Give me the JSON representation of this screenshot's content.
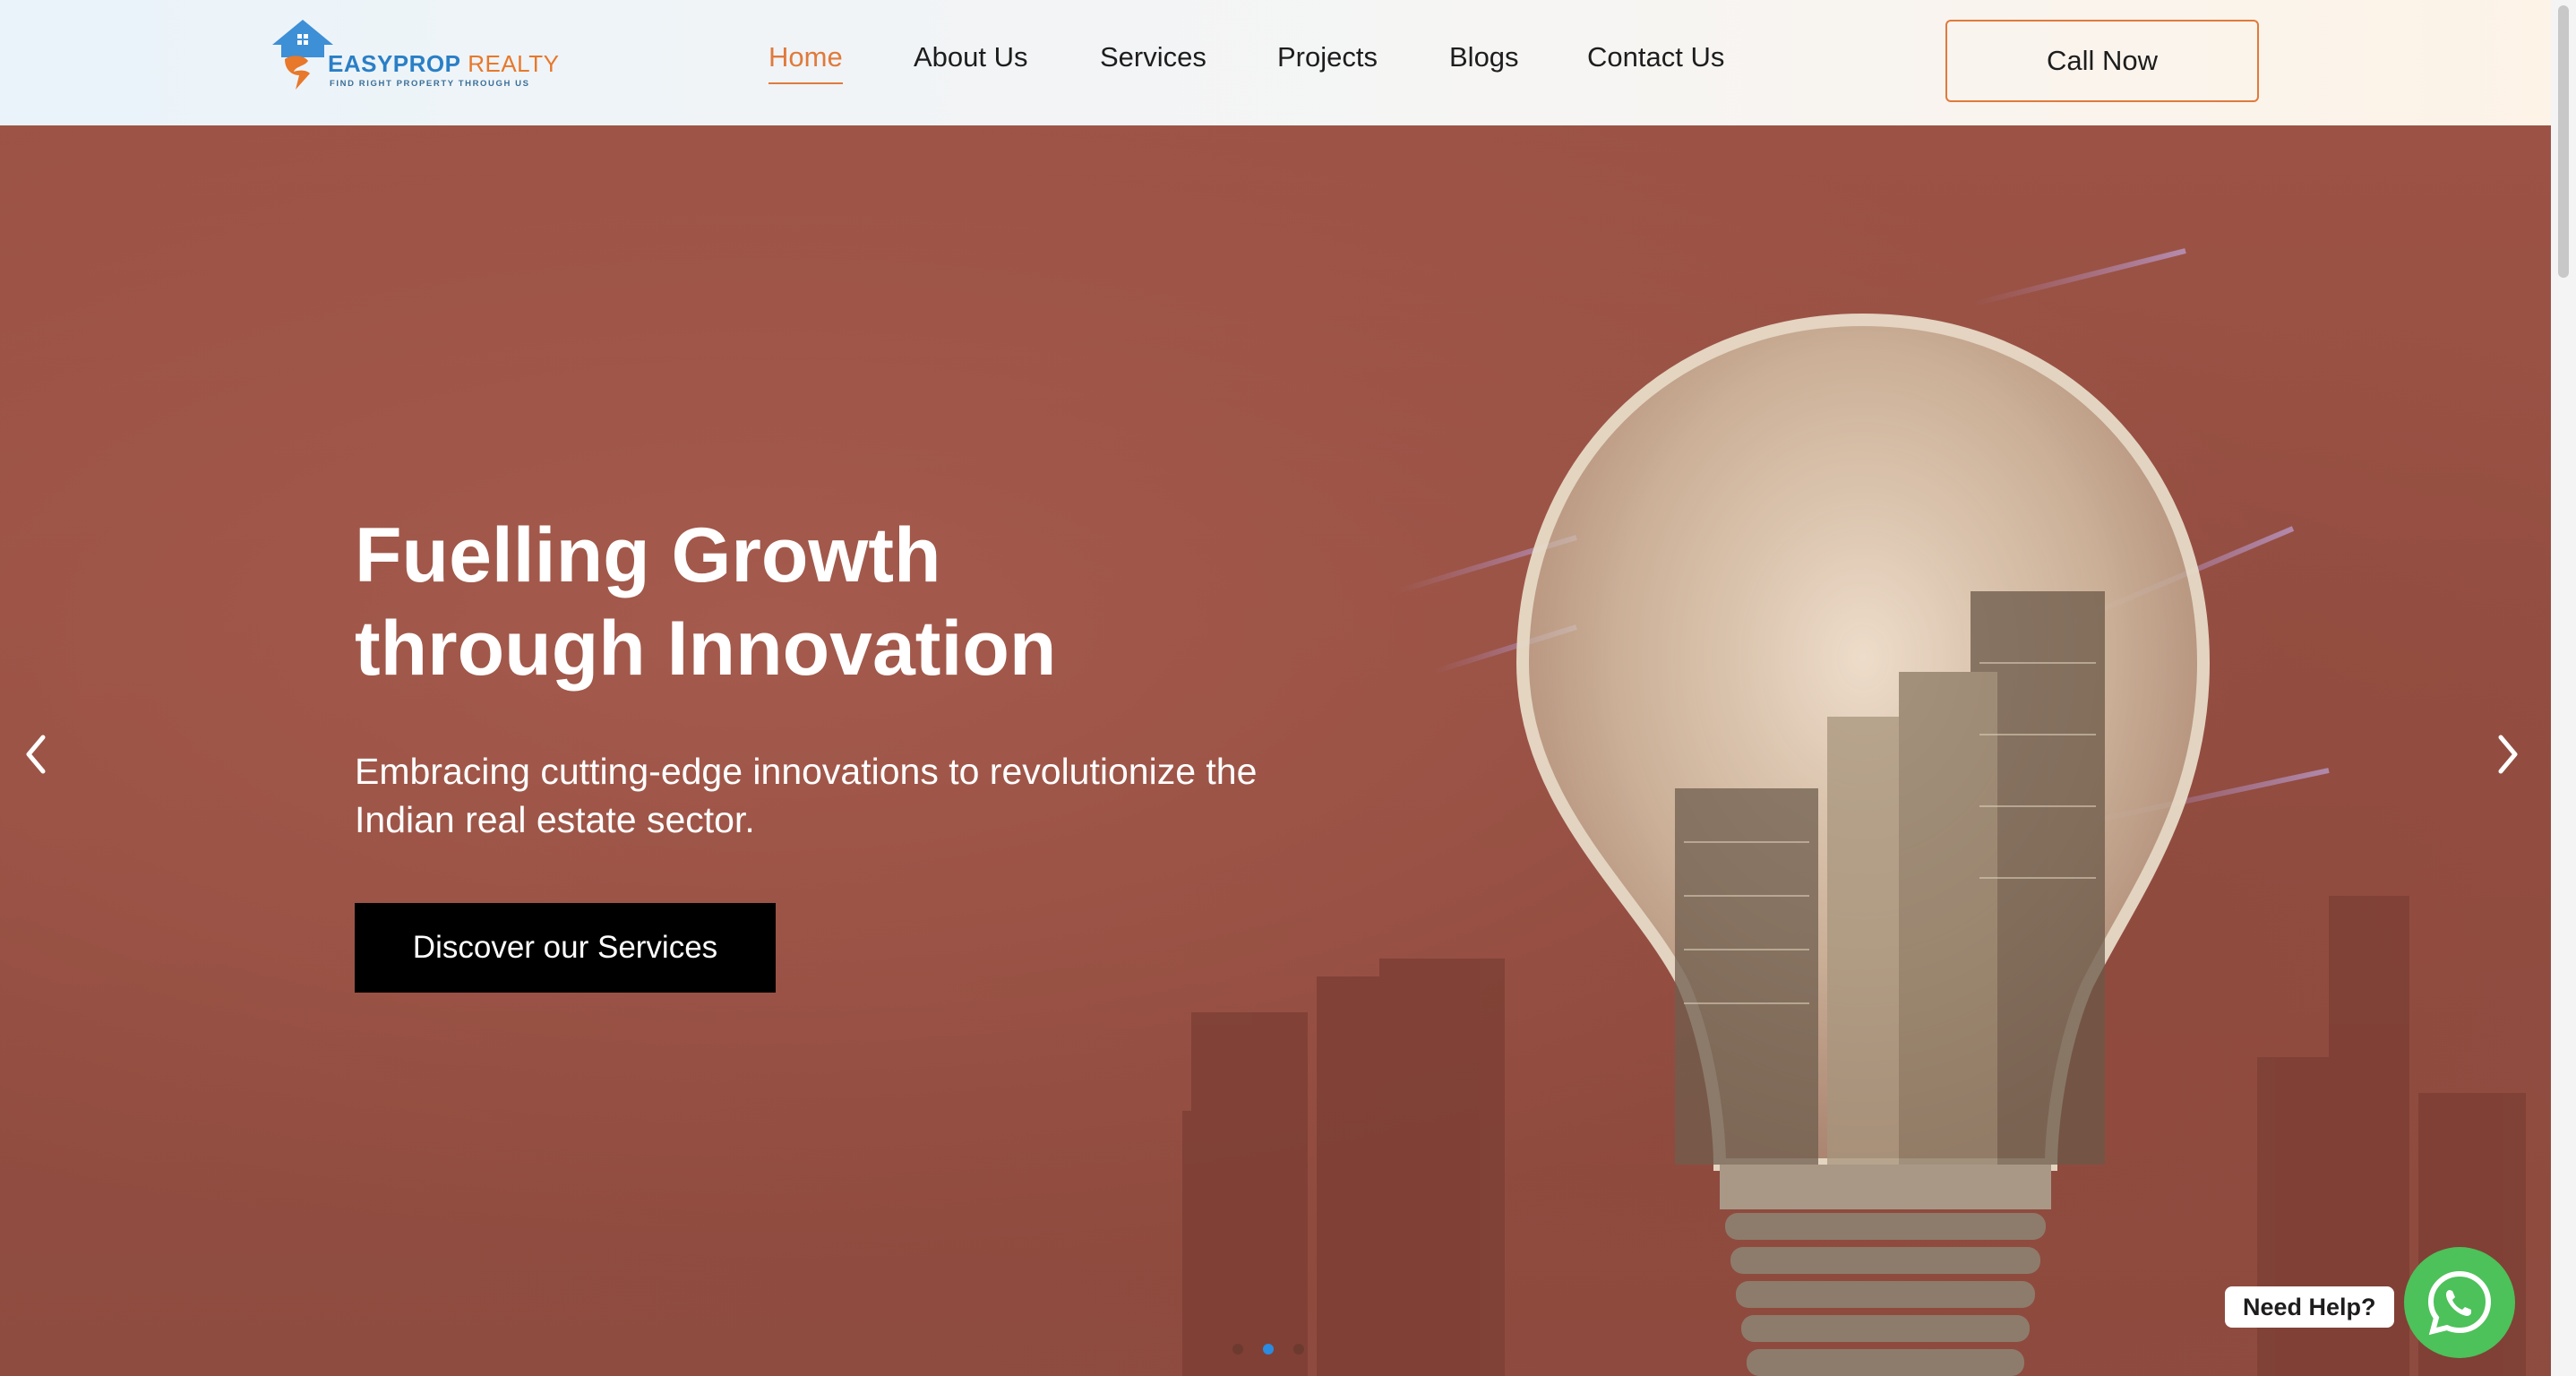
{
  "brand": {
    "name_main": "EASYPROP",
    "name_accent": " REALTY",
    "tagline": "FIND RIGHT PROPERTY THROUGH US"
  },
  "nav": {
    "items": [
      {
        "label": "Home",
        "active": true
      },
      {
        "label": "About Us",
        "active": false
      },
      {
        "label": "Services",
        "active": false
      },
      {
        "label": "Projects",
        "active": false
      },
      {
        "label": "Blogs",
        "active": false
      },
      {
        "label": "Contact Us",
        "active": false
      }
    ],
    "cta_label": "Call Now"
  },
  "hero": {
    "title": "Fuelling Growth through Innovation",
    "subtitle": "Embracing cutting-edge innovations to revolutionize the Indian real estate sector.",
    "button_label": "Discover our Services",
    "slide_count": 3,
    "active_slide": 2
  },
  "help_widget": {
    "label": "Need Help?",
    "icon": "whatsapp-icon"
  },
  "colors": {
    "accent": "#e07a3b",
    "brand_blue": "#2a7fc6",
    "hero_bg": "#8e4a3e",
    "whatsapp": "#4dc15a",
    "active_dot": "#2a8be0"
  }
}
